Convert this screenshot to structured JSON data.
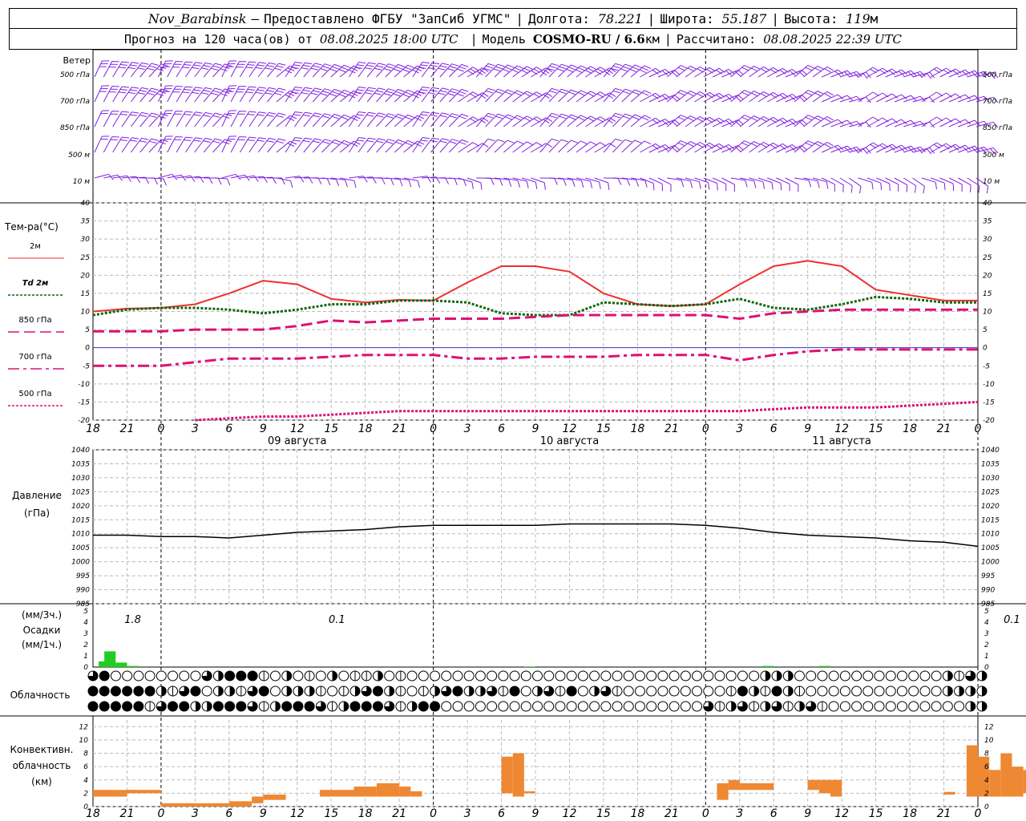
{
  "header": {
    "station": "Nov_Barabinsk",
    "dash": "–",
    "provider": "Предоставлено ФГБУ \"ЗапСиб УГМС\"",
    "lon_label": "Долгота:",
    "lon": "78.221",
    "lat_label": "Широта:",
    "lat": "55.187",
    "alt_label": "Высота:",
    "alt": "119",
    "alt_unit": "м",
    "forecast_prefix": "Прогноз на 120 часа(ов) от",
    "forecast_start": "08.08.2025 18:00 UTC",
    "model_label": "Модель",
    "model": "COSMO-RU / 6.6",
    "model_unit": "км",
    "computed_label": "Рассчитано:",
    "computed": "08.08.2025 22:39 UTC"
  },
  "wind": {
    "title": "Ветер",
    "levels": [
      "500 гПа",
      "700 гПа",
      "850 гПа",
      "500 м",
      "10 м"
    ],
    "color": "#8020e0"
  },
  "temperature": {
    "title": "Тем-ра(°C)",
    "legend": [
      {
        "label": "2м",
        "color": "#ee3030",
        "style": "solid"
      },
      {
        "label": "Td  2м",
        "color": "#116611",
        "style": "dotted"
      },
      {
        "label": "850 гПа",
        "color": "#dd1077",
        "style": "dash"
      },
      {
        "label": "700 гПа",
        "color": "#dd1077",
        "style": "dashdot"
      },
      {
        "label": "500 гПа",
        "color": "#dd1077",
        "style": "dotted"
      }
    ],
    "ticks": [
      "40",
      "35",
      "30",
      "25",
      "20",
      "15",
      "10",
      "5",
      "0",
      "-5",
      "-10",
      "-15",
      "-20"
    ]
  },
  "time_axis": {
    "hours": [
      "18",
      "21",
      "0",
      "3",
      "6",
      "9",
      "12",
      "15",
      "18",
      "21",
      "0",
      "3",
      "6",
      "9",
      "12",
      "15",
      "18",
      "21",
      "0",
      "3",
      "6",
      "9",
      "12",
      "15",
      "18",
      "21",
      "0"
    ],
    "dates": [
      "09 августа",
      "10 августа",
      "11 августа"
    ]
  },
  "pressure": {
    "title1": "Давление",
    "title2": "(гПа)",
    "ticks": [
      "1040",
      "1035",
      "1030",
      "1025",
      "1020",
      "1015",
      "1010",
      "1005",
      "1000",
      "995",
      "990",
      "985"
    ]
  },
  "precip": {
    "unit3": "(мм/3ч.)",
    "title": "Осадки",
    "unit1": "(мм/1ч.)",
    "ticks": [
      "5",
      "4",
      "3",
      "2",
      "1",
      "0"
    ],
    "labels": [
      "1.8",
      "0.1",
      "0.1",
      "0.1"
    ],
    "color": "#22cc22"
  },
  "cloud": {
    "title": "Облачность"
  },
  "convective": {
    "title1": "Конвективн.",
    "title2": "облачность",
    "title3": "(км)",
    "ticks": [
      "12",
      "10",
      "8",
      "6",
      "4",
      "2",
      "0"
    ],
    "color": "#ee8833"
  },
  "chart_data": [
    {
      "type": "line",
      "title": "Тем-ра(°C)",
      "x": [
        "18",
        "21",
        "0",
        "3",
        "6",
        "9",
        "12",
        "15",
        "18",
        "21",
        "0",
        "3",
        "6",
        "9",
        "12",
        "15",
        "18",
        "21",
        "0",
        "3",
        "6",
        "9",
        "12",
        "15",
        "18",
        "21",
        "0"
      ],
      "ylim": [
        -20,
        40
      ],
      "series": [
        {
          "name": "2м",
          "values": [
            10,
            10.8,
            11,
            12,
            15,
            18.5,
            17.5,
            13.5,
            12.5,
            13.2,
            13,
            18,
            22.5,
            22.5,
            21,
            15,
            12,
            11.5,
            12,
            17.5,
            22.5,
            24,
            22.5,
            16,
            14.5,
            13,
            13
          ]
        },
        {
          "name": "Td  2м",
          "values": [
            9,
            10.5,
            11,
            11,
            10.5,
            9.5,
            10.5,
            12,
            12,
            13,
            13,
            12.5,
            9.5,
            9,
            9,
            12.5,
            12,
            11.5,
            12,
            13.5,
            11,
            10.5,
            12,
            14,
            13.5,
            12.5,
            12.5
          ]
        },
        {
          "name": "850 гПа",
          "values": [
            4.5,
            4.5,
            4.5,
            5,
            5,
            5,
            6,
            7.5,
            7,
            7.5,
            8,
            8,
            8,
            8.5,
            9,
            9,
            9,
            9,
            9,
            8,
            9.5,
            10,
            10.5,
            10.5,
            10.5,
            10.5,
            10.5
          ]
        },
        {
          "name": "700 гПа",
          "values": [
            -5,
            -5,
            -5,
            -4,
            -3,
            -3,
            -3,
            -2.5,
            -2,
            -2,
            -2,
            -3,
            -3,
            -2.5,
            -2.5,
            -2.5,
            -2,
            -2,
            -2,
            -3.5,
            -2,
            -1,
            -0.5,
            -0.5,
            -0.5,
            -0.5,
            -0.5
          ]
        },
        {
          "name": "500 гПа",
          "values": [
            null,
            null,
            null,
            -20,
            -19.5,
            -19,
            -19,
            -18.5,
            -18,
            -17.5,
            -17.5,
            -17.5,
            -17.5,
            -17.5,
            -17.5,
            -17.5,
            -17.5,
            -17.5,
            -17.5,
            -17.5,
            -17,
            -16.5,
            -16.5,
            -16.5,
            -16,
            -15.5,
            -15
          ]
        }
      ]
    },
    {
      "type": "line",
      "title": "Давление",
      "x": [
        "18",
        "21",
        "0",
        "3",
        "6",
        "9",
        "12",
        "15",
        "18",
        "21",
        "0",
        "3",
        "6",
        "9",
        "12",
        "15",
        "18",
        "21",
        "0",
        "3",
        "6",
        "9",
        "12",
        "15",
        "18",
        "21",
        "0"
      ],
      "ylim": [
        985,
        1040
      ],
      "series": [
        {
          "name": "Давление",
          "values": [
            1009.5,
            1009.5,
            1009,
            1009,
            1008.5,
            1009.5,
            1010.5,
            1011,
            1011.5,
            1012.5,
            1013,
            1013,
            1013,
            1013,
            1013.5,
            1013.5,
            1013.5,
            1013.5,
            1013,
            1012,
            1010.5,
            1009.5,
            1009,
            1008.5,
            1007.5,
            1007,
            1005.5
          ]
        }
      ]
    },
    {
      "type": "bar",
      "title": "Осадки",
      "ylim": [
        0,
        5
      ],
      "bars": [
        {
          "h": 0.5,
          "mm": 0.5
        },
        {
          "h": 1,
          "mm": 1.4
        },
        {
          "h": 2,
          "mm": 0.4
        },
        {
          "h": 3,
          "mm": 0.1
        },
        {
          "h": 38,
          "mm": 0.05
        },
        {
          "h": 59,
          "mm": 0.1
        },
        {
          "h": 64,
          "mm": 0.1
        }
      ]
    },
    {
      "type": "bar",
      "title": "Конвективн. облачность",
      "ylim": [
        0,
        13
      ],
      "bars": [
        [
          0,
          2,
          1.5,
          2.5
        ],
        [
          1,
          3,
          1.5,
          2
        ],
        [
          2,
          4,
          2,
          2.5
        ],
        [
          3,
          6,
          2,
          2.5
        ],
        [
          6,
          12,
          0,
          0.5
        ],
        [
          12,
          14,
          0,
          0.8
        ],
        [
          14,
          15,
          0.5,
          1.5
        ],
        [
          15,
          17,
          1,
          1.8
        ],
        [
          20,
          23,
          1.5,
          2.5
        ],
        [
          23,
          25,
          1.5,
          3
        ],
        [
          25,
          27,
          1.5,
          3.5
        ],
        [
          27,
          28,
          1.5,
          3
        ],
        [
          28,
          29,
          1.5,
          2.3
        ],
        [
          36,
          37,
          2,
          7.5
        ],
        [
          37,
          38,
          1.5,
          8
        ],
        [
          38,
          39,
          2,
          2.3
        ],
        [
          55,
          56,
          1,
          3.5
        ],
        [
          56,
          57,
          2.5,
          4
        ],
        [
          57,
          60,
          2.5,
          3.5
        ],
        [
          63,
          64,
          2.5,
          4
        ],
        [
          64,
          65,
          2,
          4
        ],
        [
          65,
          66,
          1.5,
          4
        ],
        [
          75,
          76,
          1.8,
          2.2
        ],
        [
          77,
          78,
          1.5,
          9.2
        ],
        [
          78,
          79,
          1.5,
          7.5
        ],
        [
          79,
          80,
          1.5,
          5.5
        ],
        [
          80,
          81,
          1.5,
          8
        ],
        [
          81,
          82,
          1.5,
          6
        ],
        [
          82,
          83,
          2,
          5.5
        ],
        [
          83,
          84,
          2,
          5
        ],
        [
          84,
          85,
          1.5,
          3.5
        ],
        [
          85,
          86,
          2,
          5
        ]
      ]
    }
  ]
}
